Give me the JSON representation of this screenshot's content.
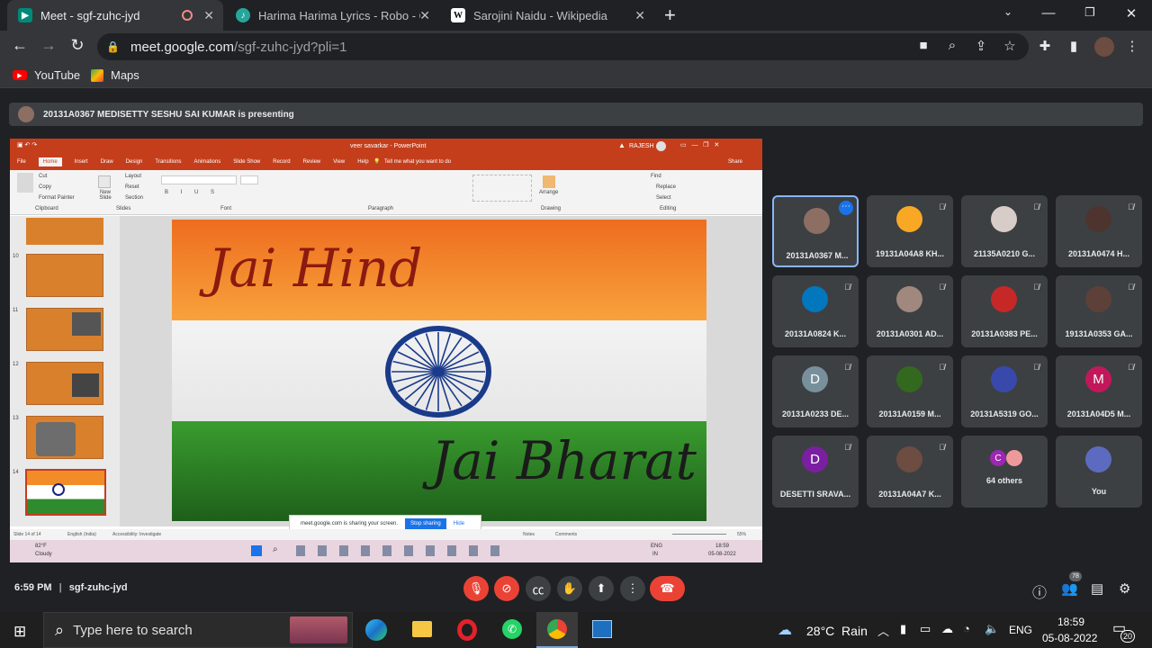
{
  "browser": {
    "tabs": [
      {
        "label": "Meet - sgf-zuhc-jyd",
        "active": true
      },
      {
        "label": "Harima Harima Lyrics - Robo - Or",
        "active": false
      },
      {
        "label": "Sarojini Naidu - Wikipedia",
        "active": false
      }
    ],
    "url_host": "meet.google.com",
    "url_path": "/sgf-zuhc-jyd?pli=1",
    "bookmarks": [
      "YouTube",
      "Maps"
    ]
  },
  "meet": {
    "presenting_text": "20131A0367 MEDISETTY SESHU SAI KUMAR is presenting",
    "time": "6:59 PM",
    "meeting_code": "sgf-zuhc-jyd",
    "participant_count": "78",
    "participants": [
      {
        "name": "20131A0367 M...",
        "avatar": "photo",
        "color": "#8d6e63",
        "pinned": true
      },
      {
        "name": "19131A04A8 KH...",
        "avatar": "photo",
        "color": "#f9a825"
      },
      {
        "name": "21135A0210 G...",
        "avatar": "photo",
        "color": "#d7ccc8"
      },
      {
        "name": "20131A0474 H...",
        "avatar": "photo",
        "color": "#4e342e"
      },
      {
        "name": "20131A0824 K...",
        "avatar": "photo",
        "color": "#0277bd"
      },
      {
        "name": "20131A0301 AD...",
        "avatar": "photo",
        "color": "#a1887f"
      },
      {
        "name": "20131A0383 PE...",
        "avatar": "photo",
        "color": "#c62828"
      },
      {
        "name": "19131A0353 GA...",
        "avatar": "photo",
        "color": "#5d4037"
      },
      {
        "name": "20131A0233 DE...",
        "avatar": "D",
        "color": "#78909c"
      },
      {
        "name": "20131A0159 M...",
        "avatar": "photo",
        "color": "#33691e"
      },
      {
        "name": "20131A5319 GO...",
        "avatar": "photo",
        "color": "#3949ab"
      },
      {
        "name": "20131A04D5 M...",
        "avatar": "M",
        "color": "#c2185b"
      },
      {
        "name": "DESETTI SRAVA...",
        "avatar": "D",
        "color": "#7b1fa2"
      },
      {
        "name": "20131A04A7 K...",
        "avatar": "photo",
        "color": "#6d4c41"
      },
      {
        "name": "64 others",
        "avatar": "C",
        "color": "#9c27b0"
      },
      {
        "name": "You",
        "avatar": "photo",
        "color": "#5c6bc0"
      }
    ]
  },
  "slide": {
    "title_bar": "veer savarkar - PowerPoint",
    "user": "RAJESH",
    "ribbon_tabs": [
      "File",
      "Home",
      "Insert",
      "Draw",
      "Design",
      "Transitions",
      "Animations",
      "Slide Show",
      "Record",
      "Review",
      "View",
      "Help"
    ],
    "tell_me": "Tell me what you want to do",
    "share": "Share",
    "groups": [
      "Clipboard",
      "Slides",
      "Font",
      "Paragraph",
      "Drawing",
      "Editing"
    ],
    "clipboard_items": [
      "Cut",
      "Copy",
      "Format Painter"
    ],
    "slides_items": [
      "Layout",
      "Reset",
      "Section"
    ],
    "new_slide": "New Slide",
    "arrange": "Arrange",
    "editing_items": [
      "Find",
      "Replace",
      "Select"
    ],
    "thumb_numbers": [
      "10",
      "11",
      "12",
      "13",
      "14"
    ],
    "top_text": "Jai Hind",
    "bottom_text": "Jai Bharat",
    "status_slide": "Slide 14 of 14",
    "status_lang": "English (India)",
    "status_access": "Accessibility: Investigate",
    "notes": "Notes",
    "comments": "Comments",
    "zoom": "55%",
    "sharing_text": "meet.google.com is sharing your screen.",
    "stop_sharing": "Stop sharing",
    "hide": "Hide",
    "inner_weather_temp": "82°F",
    "inner_weather_cond": "Cloudy",
    "inner_lang": "ENG",
    "inner_lang2": "IN",
    "inner_time": "18:59",
    "inner_date": "05-08-2022"
  },
  "taskbar": {
    "search_placeholder": "Type here to search",
    "weather": "28°C  Rain",
    "lang": "ENG",
    "time": "18:59",
    "date": "05-08-2022",
    "notification_count": "20"
  }
}
